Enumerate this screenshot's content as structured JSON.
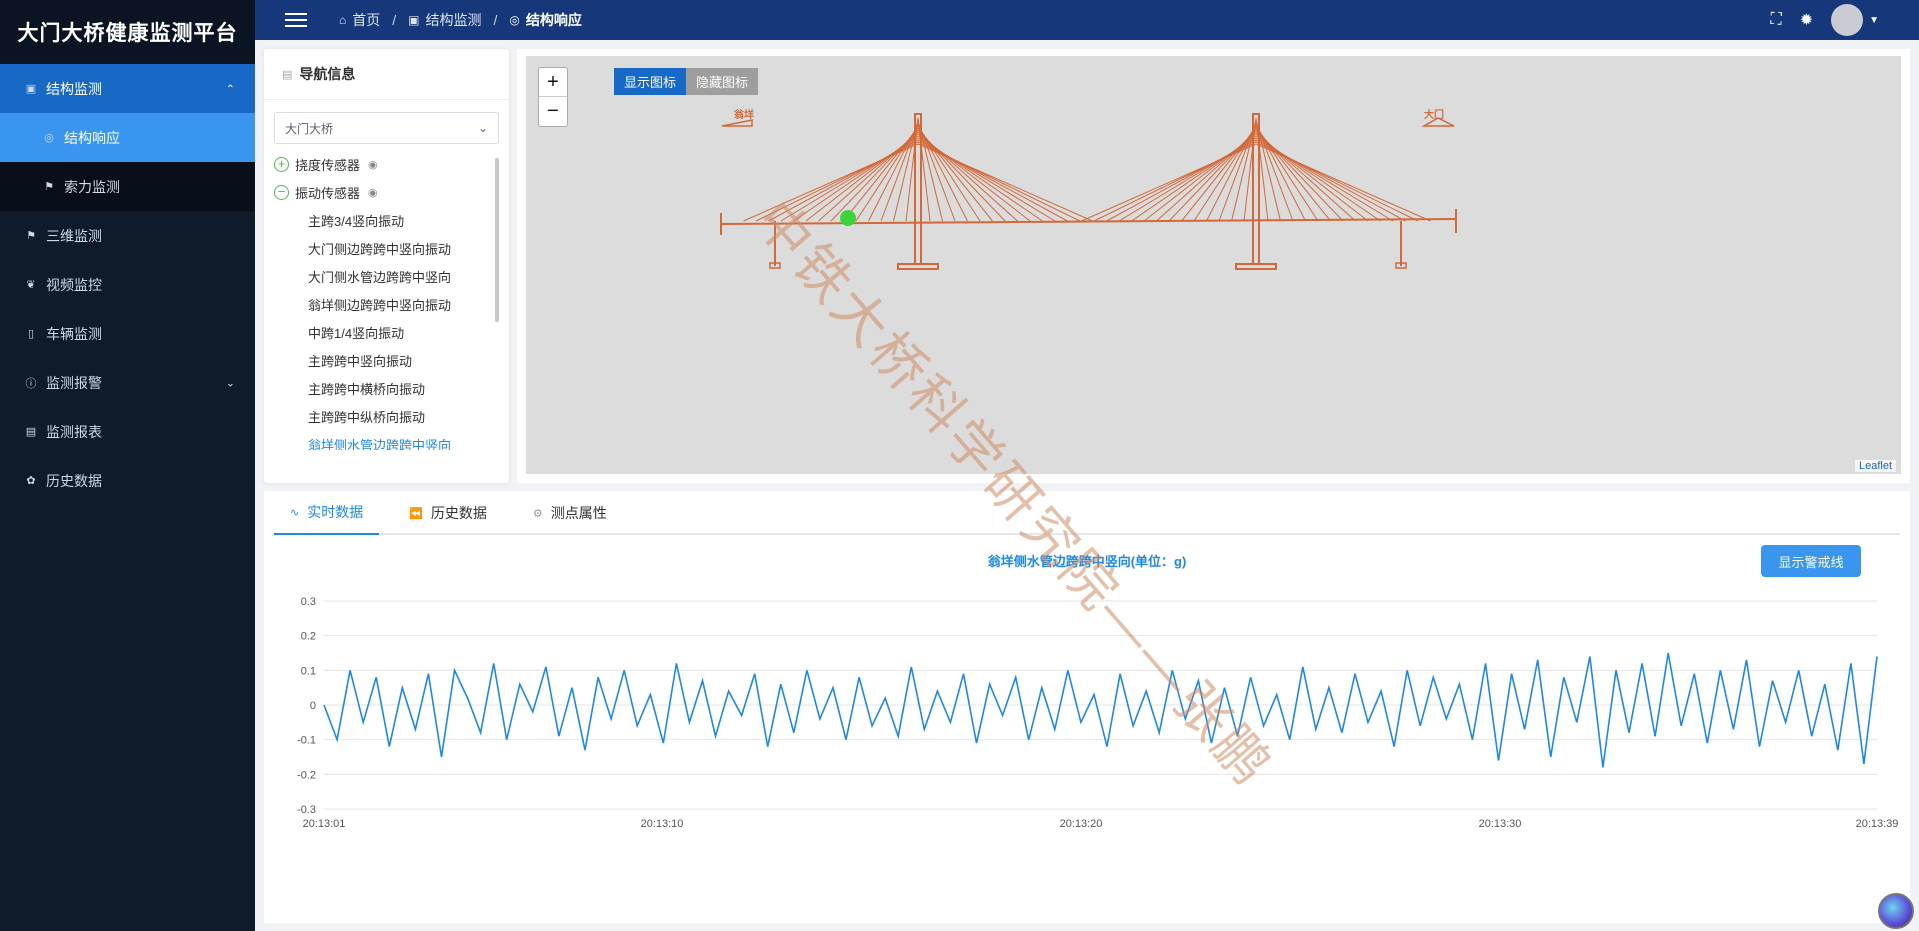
{
  "app": {
    "title": "大门大桥健康监测平台"
  },
  "sidebar": {
    "items": [
      {
        "label": "结构监测",
        "icon": "image-icon",
        "state": "open",
        "chevron": "^"
      },
      {
        "label": "结构响应",
        "icon": "target-icon",
        "state": "active"
      },
      {
        "label": "索力监测",
        "icon": "flag-icon",
        "state": "sub"
      },
      {
        "label": "三维监测",
        "icon": "flag-icon",
        "state": "normal"
      },
      {
        "label": "视频监控",
        "icon": "leaf-icon",
        "state": "normal"
      },
      {
        "label": "车辆监测",
        "icon": "phone-icon",
        "state": "normal"
      },
      {
        "label": "监测报警",
        "icon": "info-icon",
        "state": "normal",
        "chevron": "v"
      },
      {
        "label": "监测报表",
        "icon": "book-icon",
        "state": "normal"
      },
      {
        "label": "历史数据",
        "icon": "paw-icon",
        "state": "normal"
      }
    ]
  },
  "topbar": {
    "breadcrumb": [
      {
        "label": "首页",
        "icon": "home-icon"
      },
      {
        "label": "结构监测",
        "icon": "image-icon"
      },
      {
        "label": "结构响应",
        "icon": "target-icon"
      }
    ],
    "separator": "/"
  },
  "nav_panel": {
    "title": "导航信息",
    "select_value": "大门大桥",
    "tree": [
      {
        "label": "挠度传感器",
        "expander": "+",
        "type": "group"
      },
      {
        "label": "振动传感器",
        "expander": "−",
        "type": "group"
      },
      {
        "label": "主跨3/4竖向振动",
        "type": "leaf"
      },
      {
        "label": "大门侧边跨跨中竖向振动",
        "type": "leaf"
      },
      {
        "label": "大门侧水管边跨跨中竖向",
        "type": "leaf"
      },
      {
        "label": "翁垟侧边跨跨中竖向振动",
        "type": "leaf"
      },
      {
        "label": "中跨1/4竖向振动",
        "type": "leaf"
      },
      {
        "label": "主跨跨中竖向振动",
        "type": "leaf"
      },
      {
        "label": "主跨跨中横桥向振动",
        "type": "leaf"
      },
      {
        "label": "主跨跨中纵桥向振动",
        "type": "leaf"
      },
      {
        "label": "翁垟侧水管边跨跨中竖向",
        "type": "leaf",
        "highlight": true
      }
    ]
  },
  "map": {
    "zoom_in": "+",
    "zoom_out": "−",
    "show_icons": "显示图标",
    "hide_icons": "隐藏图标",
    "label_left": "翁垟",
    "label_right": "大门",
    "attribution": "Leaflet",
    "bridge_color": "#d2693a"
  },
  "data_panel": {
    "tabs": [
      {
        "label": "实时数据",
        "icon": "pulse-icon",
        "active": true
      },
      {
        "label": "历史数据",
        "icon": "rewind-icon",
        "active": false
      },
      {
        "label": "测点属性",
        "icon": "gear-icon",
        "active": false
      }
    ],
    "alert_button": "显示警戒线"
  },
  "chart_data": {
    "type": "line",
    "title": "翁垟侧水管边跨跨中竖向(单位：g)",
    "ylim": [
      -0.3,
      0.3
    ],
    "yticks": [
      "0.3",
      "0.2",
      "0.1",
      "0",
      "-0.1",
      "-0.2",
      "-0.3"
    ],
    "xticks": [
      "20:13:01",
      "20:13:10",
      "20:13:20",
      "20:13:30",
      "20:13:39"
    ],
    "color": "#1e88e5",
    "series": [
      {
        "values": [
          0.0,
          -0.1,
          0.1,
          -0.05,
          0.08,
          -0.12,
          0.05,
          -0.07,
          0.09,
          -0.15,
          0.1,
          0.02,
          -0.08,
          0.12,
          -0.1,
          0.06,
          -0.02,
          0.11,
          -0.09,
          0.05,
          -0.13,
          0.08,
          -0.04,
          0.1,
          -0.06,
          0.03,
          -0.11,
          0.12,
          -0.05,
          0.07,
          -0.09,
          0.04,
          -0.03,
          0.09,
          -0.12,
          0.06,
          -0.08,
          0.1,
          -0.04,
          0.05,
          -0.1,
          0.08,
          -0.06,
          0.02,
          -0.09,
          0.11,
          -0.07,
          0.04,
          -0.05,
          0.09,
          -0.11,
          0.06,
          -0.03,
          0.08,
          -0.1,
          0.05,
          -0.07,
          0.1,
          -0.05,
          0.03,
          -0.12,
          0.09,
          -0.06,
          0.04,
          -0.08,
          0.1,
          -0.04,
          0.07,
          -0.11,
          0.05,
          -0.09,
          0.08,
          -0.06,
          0.03,
          -0.1,
          0.11,
          -0.07,
          0.05,
          -0.08,
          0.09,
          -0.05,
          0.04,
          -0.12,
          0.1,
          -0.06,
          0.08,
          -0.04,
          0.06,
          -0.1,
          0.12,
          -0.16,
          0.09,
          -0.07,
          0.13,
          -0.15,
          0.08,
          -0.05,
          0.14,
          -0.18,
          0.1,
          -0.08,
          0.12,
          -0.09,
          0.15,
          -0.06,
          0.09,
          -0.11,
          0.1,
          -0.07,
          0.13,
          -0.12,
          0.07,
          -0.05,
          0.1,
          -0.09,
          0.06,
          -0.13,
          0.12,
          -0.17,
          0.14
        ]
      }
    ]
  }
}
